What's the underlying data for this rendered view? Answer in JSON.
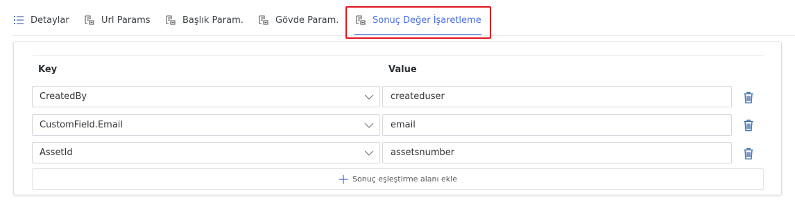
{
  "tabs": [
    {
      "label": "Detaylar",
      "icon": "list-icon"
    },
    {
      "label": "Url Params",
      "icon": "form-icon"
    },
    {
      "label": "Başlık Param.",
      "icon": "form-icon"
    },
    {
      "label": "Gövde Param.",
      "icon": "form-icon"
    },
    {
      "label": "Sonuç Değer İşaretleme",
      "icon": "form-icon",
      "active": true
    }
  ],
  "columns": {
    "key": "Key",
    "value": "Value"
  },
  "rows": [
    {
      "key": "CreatedBy",
      "value": "createduser"
    },
    {
      "key": "CustomField.Email",
      "value": "email"
    },
    {
      "key": "AssetId",
      "value": "assetsnumber"
    }
  ],
  "add_button": {
    "label": "Sonuç eşleştirme alanı ekle"
  },
  "colors": {
    "accent": "#4a6ee0",
    "highlight": "#e0141e",
    "trash": "#3d6fb0"
  }
}
